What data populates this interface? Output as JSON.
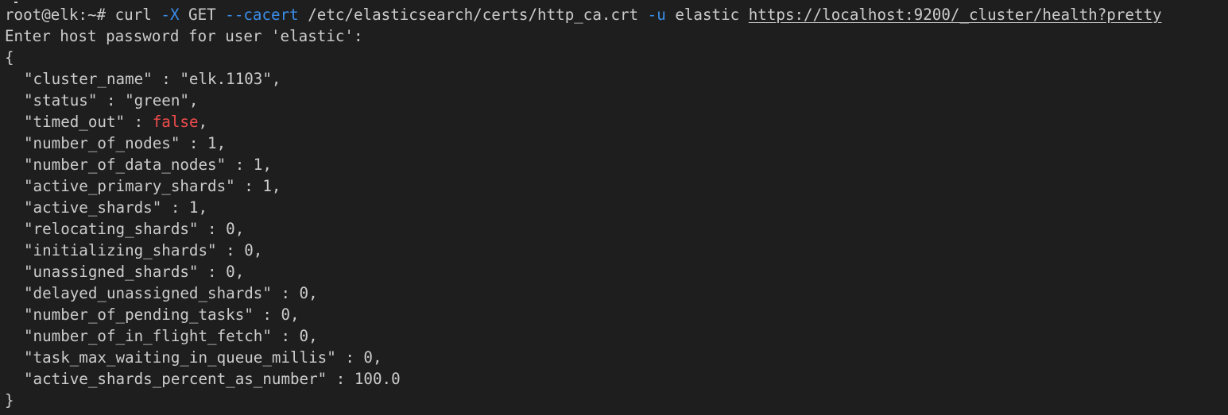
{
  "terminal": {
    "command": {
      "prompt": "root@elk:~# ",
      "curl": "curl ",
      "flag_x": "-X",
      "method": " GET ",
      "flag_cacert": "--cacert",
      "cert_path": " /etc/elasticsearch/certs/http_ca.crt ",
      "flag_u": "-u",
      "user": " elastic ",
      "url": "https://localhost:9200/_cluster/health?pretty"
    },
    "password_prompt": "Enter host password for user 'elastic':",
    "open_brace": "{",
    "close_brace": "}",
    "response": [
      {
        "line": "\"cluster_name\" : \"elk.1103\","
      },
      {
        "line": "\"status\" : \"green\","
      },
      {
        "key": "\"timed_out\" : ",
        "value": "false",
        "suffix": ","
      },
      {
        "line": "\"number_of_nodes\" : 1,"
      },
      {
        "line": "\"number_of_data_nodes\" : 1,"
      },
      {
        "line": "\"active_primary_shards\" : 1,"
      },
      {
        "line": "\"active_shards\" : 1,"
      },
      {
        "line": "\"relocating_shards\" : 0,"
      },
      {
        "line": "\"initializing_shards\" : 0,"
      },
      {
        "line": "\"unassigned_shards\" : 0,"
      },
      {
        "line": "\"delayed_unassigned_shards\" : 0,"
      },
      {
        "line": "\"number_of_pending_tasks\" : 0,"
      },
      {
        "line": "\"number_of_in_flight_fetch\" : 0,"
      },
      {
        "line": "\"task_max_waiting_in_queue_millis\" : 0,"
      },
      {
        "line": "\"active_shards_percent_as_number\" : 100.0"
      }
    ]
  },
  "colors": {
    "background": "#1e1e1e",
    "text": "#cccccc",
    "flag": "#3b8eea",
    "boolean": "#f14c4c"
  }
}
